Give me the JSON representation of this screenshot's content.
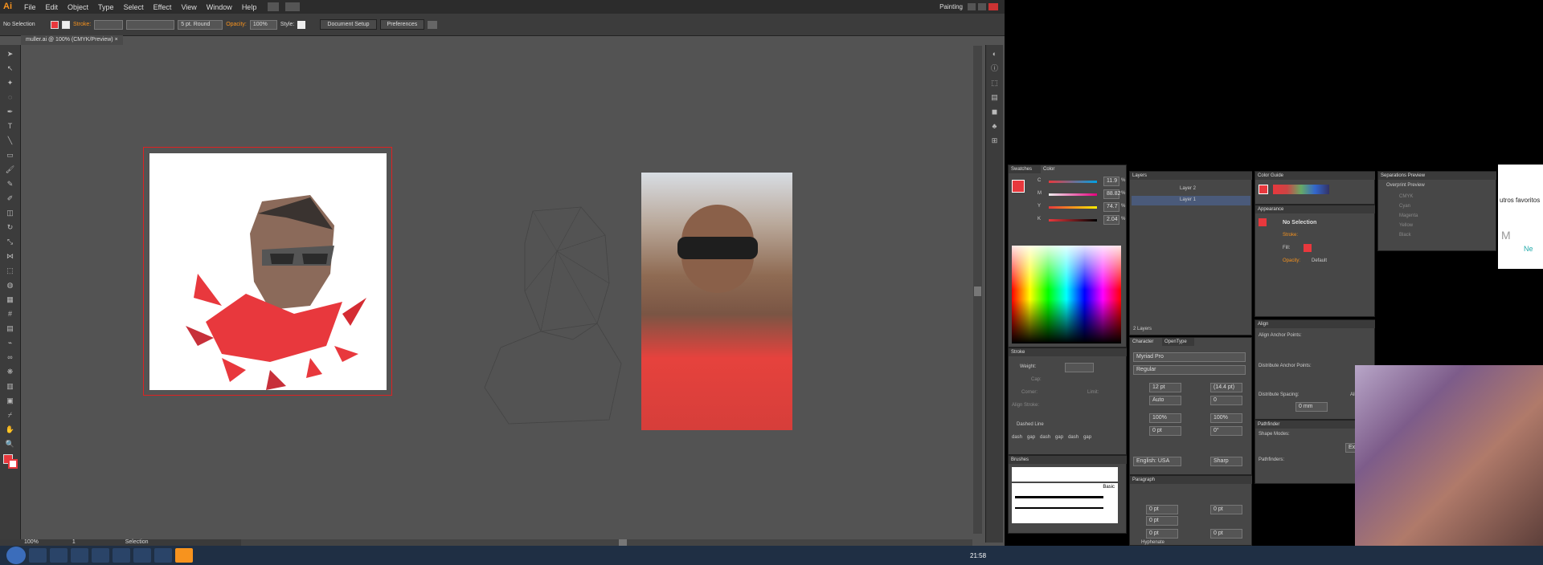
{
  "window": {
    "title_app": "Ai",
    "workspace": "Painting"
  },
  "menus": [
    "File",
    "Edit",
    "Object",
    "Type",
    "Select",
    "Effect",
    "View",
    "Window",
    "Help"
  ],
  "control_bar": {
    "selection": "No Selection",
    "stroke_label": "Stroke:",
    "brush": "5 pt. Round",
    "opacity_label": "Opacity:",
    "opacity": "100%",
    "style_label": "Style:",
    "doc_setup": "Document Setup",
    "preferences": "Preferences"
  },
  "doc_tab": "muller.ai @ 100% (CMYK/Preview)",
  "status": {
    "zoom": "100%",
    "page": "1",
    "tool": "Selection"
  },
  "panels": {
    "swatches_tab": "Swatches",
    "color_tab": "Color",
    "color": {
      "c": "11.9",
      "m": "88.82",
      "y": "74.7",
      "k": "2.04",
      "pct": "%"
    },
    "layers": {
      "title": "Layers",
      "items": [
        "Layer 2",
        "Layer 1"
      ],
      "count": "2 Layers"
    },
    "color_guide": "Color Guide",
    "appearance": {
      "title": "Appearance",
      "no_selection": "No Selection",
      "stroke": "Stroke:",
      "fill": "Fill:",
      "opacity": "Opacity:",
      "opacity_val": "Default"
    },
    "stroke_panel": {
      "title": "Stroke",
      "weight": "Weight:",
      "cap": "Cap:",
      "corner": "Corner:",
      "limit": "Limit:",
      "align": "Align Stroke:",
      "dashed": "Dashed Line",
      "dash": "dash",
      "gap": "gap"
    },
    "brushes": {
      "title": "Brushes",
      "basic": "Basic"
    },
    "character": {
      "title": "Character",
      "tab2": "OpenType",
      "font": "Myriad Pro",
      "style": "Regular",
      "size": "12 pt",
      "leading": "(14.4 pt)",
      "kern": "Auto",
      "track": "0",
      "scale_v": "100%",
      "scale_h": "100%",
      "baseline": "0 pt",
      "rot": "0°",
      "lang": "English: USA",
      "aa": "Sharp"
    },
    "paragraph": {
      "title": "Paragraph",
      "v1": "0 pt",
      "v2": "0 pt",
      "v3": "0 pt",
      "v4": "0 pt",
      "v5": "0 pt",
      "hyphenate": "Hyphenate"
    },
    "align": {
      "title": "Align",
      "anchor": "Align Anchor Points:",
      "distribute": "Distribute Anchor Points:",
      "spacing": "Distribute Spacing:",
      "align_to": "Align To:",
      "spacing_val": "0 mm"
    },
    "pathfinder": {
      "title": "Pathfinder",
      "shape_modes": "Shape Modes:",
      "expand": "Expand",
      "pathfinders": "Pathfinders:"
    },
    "separations": {
      "title": "Separations Preview",
      "overprint": "Overprint Preview",
      "items": [
        "CMYK",
        "Cyan",
        "Magenta",
        "Yellow",
        "Black"
      ]
    }
  },
  "browser_partial": {
    "text": "utros favoritos",
    "tile": "M",
    "tile2": "Ne"
  },
  "taskbar": {
    "time": "21:58"
  },
  "colors": {
    "accent": "#e8383d",
    "cyan": "#00a0e3",
    "magenta": "#e6007e",
    "yellow": "#ffed00"
  }
}
